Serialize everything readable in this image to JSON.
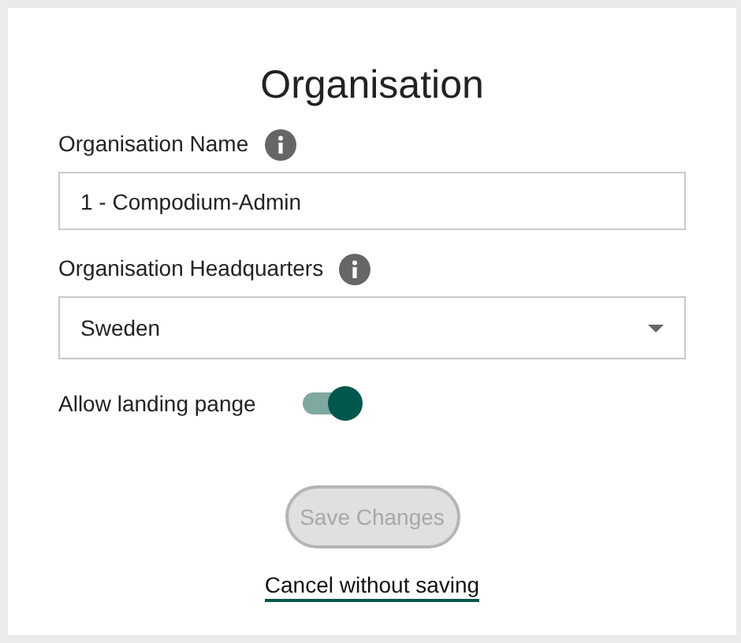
{
  "title": "Organisation",
  "fields": [
    {
      "kind": "text",
      "label": "Organisation Name",
      "value": "1 - Compodium-Admin"
    },
    {
      "kind": "select",
      "label": "Organisation Headquarters",
      "value": "Sweden"
    }
  ],
  "toggle": {
    "label": "Allow landing pange",
    "on": true
  },
  "save_button": {
    "label": "Save Changes",
    "disabled": true
  },
  "cancel_link": "Cancel without saving"
}
